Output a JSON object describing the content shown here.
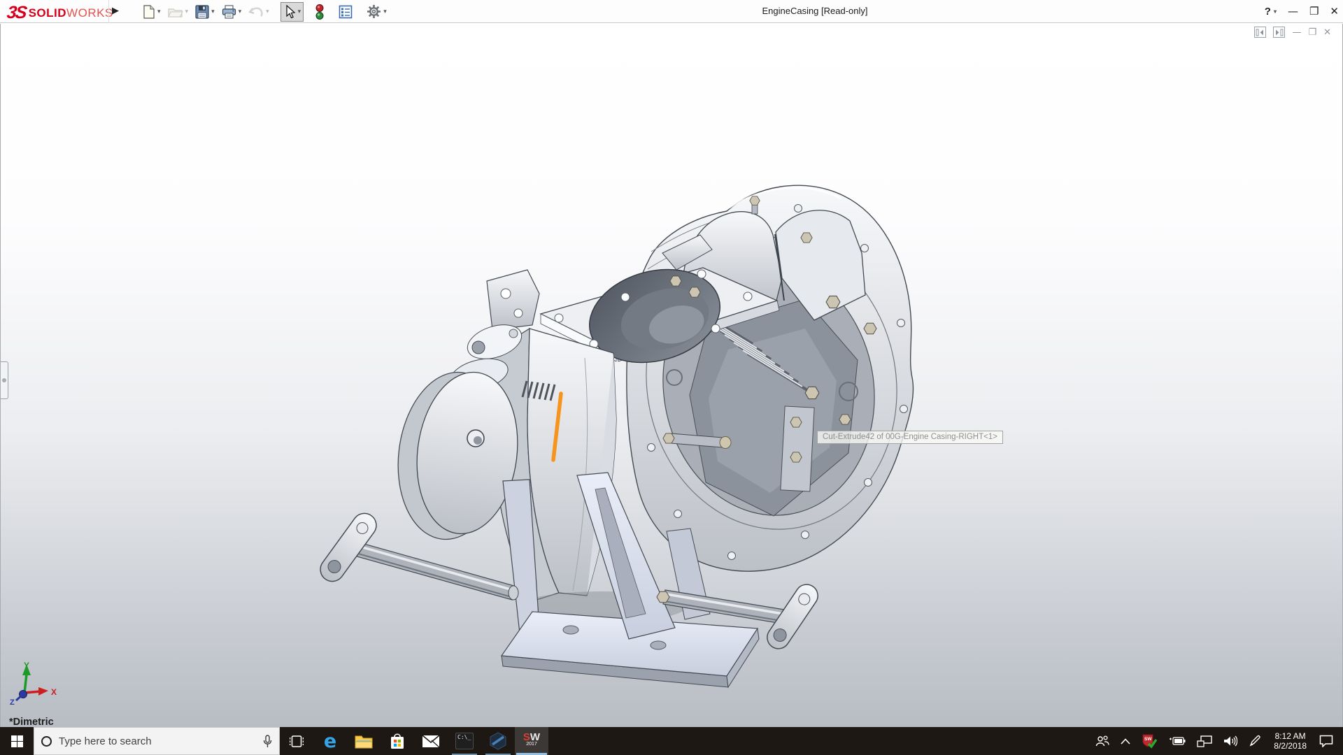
{
  "window": {
    "title": "EngineCasing [Read-only]",
    "brand": {
      "glyph": "3S",
      "solid": "SOLID",
      "works": "WORKS"
    },
    "controls": {
      "help": "?",
      "help_caret": "▾",
      "minimize": "—",
      "restore": "❐",
      "close": "✕"
    },
    "flyout_arrow": "▶"
  },
  "toolbar": {
    "caret": "▾",
    "items": [
      {
        "name": "new-document",
        "enabled": true
      },
      {
        "name": "open",
        "enabled": false
      },
      {
        "name": "save",
        "enabled": true
      },
      {
        "name": "print",
        "enabled": true
      },
      {
        "name": "undo",
        "enabled": false
      },
      {
        "name": "select",
        "enabled": true,
        "pressed": true
      },
      {
        "name": "rebuild-traffic-light",
        "enabled": true
      },
      {
        "name": "display-report",
        "enabled": true
      },
      {
        "name": "options-gear",
        "enabled": true
      }
    ]
  },
  "viewport": {
    "tooltip": "Cut-Extrude42 of 00G-Engine Casing-RIGHT<1>",
    "view_label": "*Dimetric",
    "triad": {
      "x": "X",
      "y": "Y",
      "z": "Z"
    },
    "selection_color": "#F7941E"
  },
  "taskbar": {
    "search_placeholder": "Type here to search",
    "cmd_text": "C:\\_",
    "edge_letter": "e",
    "sw_icon": {
      "s": "S",
      "w": "W",
      "year": "2017"
    },
    "clock": {
      "time": "8:12 AM",
      "date": "8/2/2018"
    },
    "icons": [
      "start",
      "search",
      "microphone",
      "task-view",
      "edge",
      "file-explorer",
      "store",
      "mail",
      "command-prompt",
      "hexagon-app",
      "solidworks-2017",
      "people",
      "chevron-up",
      "sw-resource-monitor",
      "battery",
      "network",
      "speaker",
      "pen",
      "clock",
      "action-center"
    ]
  }
}
